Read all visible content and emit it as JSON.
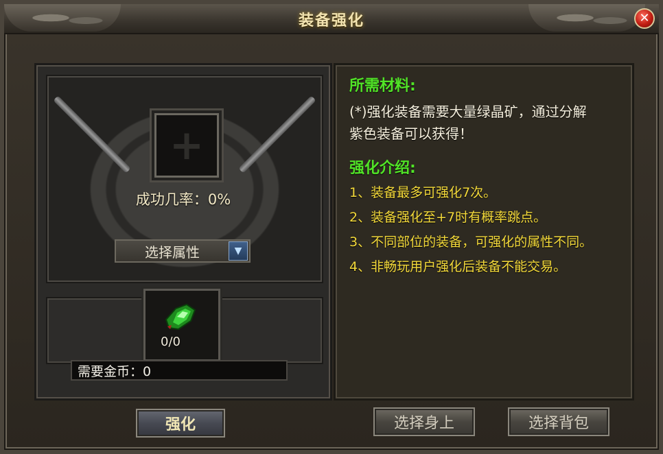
{
  "window": {
    "title": "装备强化"
  },
  "left": {
    "success_rate_label": "成功几率：0%",
    "select_attribute": "选择属性",
    "material_count": "0/0",
    "gold_required": "需要金币：0"
  },
  "right": {
    "materials_title": "所需材料:",
    "materials_desc_line1": "(*)强化装备需要大量绿晶矿，通过分解",
    "materials_desc_line2": "紫色装备可以获得！",
    "intro_title": "强化介绍:",
    "intro_items": [
      "1、装备最多可强化7次。",
      "2、装备强化至+7时有概率跳点。",
      "3、不同部位的装备，可强化的属性不同。",
      "4、非畅玩用户强化后装备不能交易。"
    ]
  },
  "buttons": {
    "strengthen": "强化",
    "select_body": "选择身上",
    "select_bag": "选择背包"
  },
  "colors": {
    "section_title": "#51e327",
    "intro_text": "#f3d93a",
    "close_button": "#c01d12"
  },
  "icons": {
    "close": "close-icon",
    "dropdown": "chevron-down-icon",
    "gem": "green-crystal-icon",
    "plus": "plus-icon"
  }
}
